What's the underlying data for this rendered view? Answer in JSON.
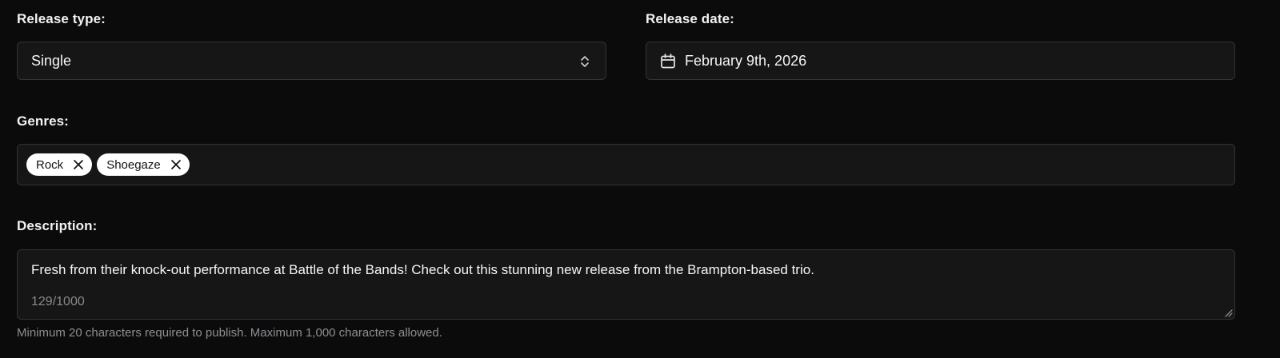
{
  "release_type": {
    "label": "Release type:",
    "value": "Single",
    "icon": "chevron-up-down-icon"
  },
  "release_date": {
    "label": "Release date:",
    "value": "February 9th, 2026",
    "icon": "calendar-icon"
  },
  "genres": {
    "label": "Genres:",
    "tags": [
      {
        "label": "Rock",
        "remove_icon": "close-icon"
      },
      {
        "label": "Shoegaze",
        "remove_icon": "close-icon"
      }
    ]
  },
  "description": {
    "label": "Description:",
    "value": "Fresh from their knock-out performance at Battle of the Bands! Check out this stunning new release from the Brampton-based trio.",
    "counter": "129/1000",
    "help_text": "Minimum 20 characters required to publish. Maximum 1,000 characters allowed."
  },
  "colors": {
    "background": "#0b0b0c",
    "field_background": "#161617",
    "field_border": "#333336",
    "chip_background": "#ffffff",
    "muted_text": "#8e8e93"
  }
}
